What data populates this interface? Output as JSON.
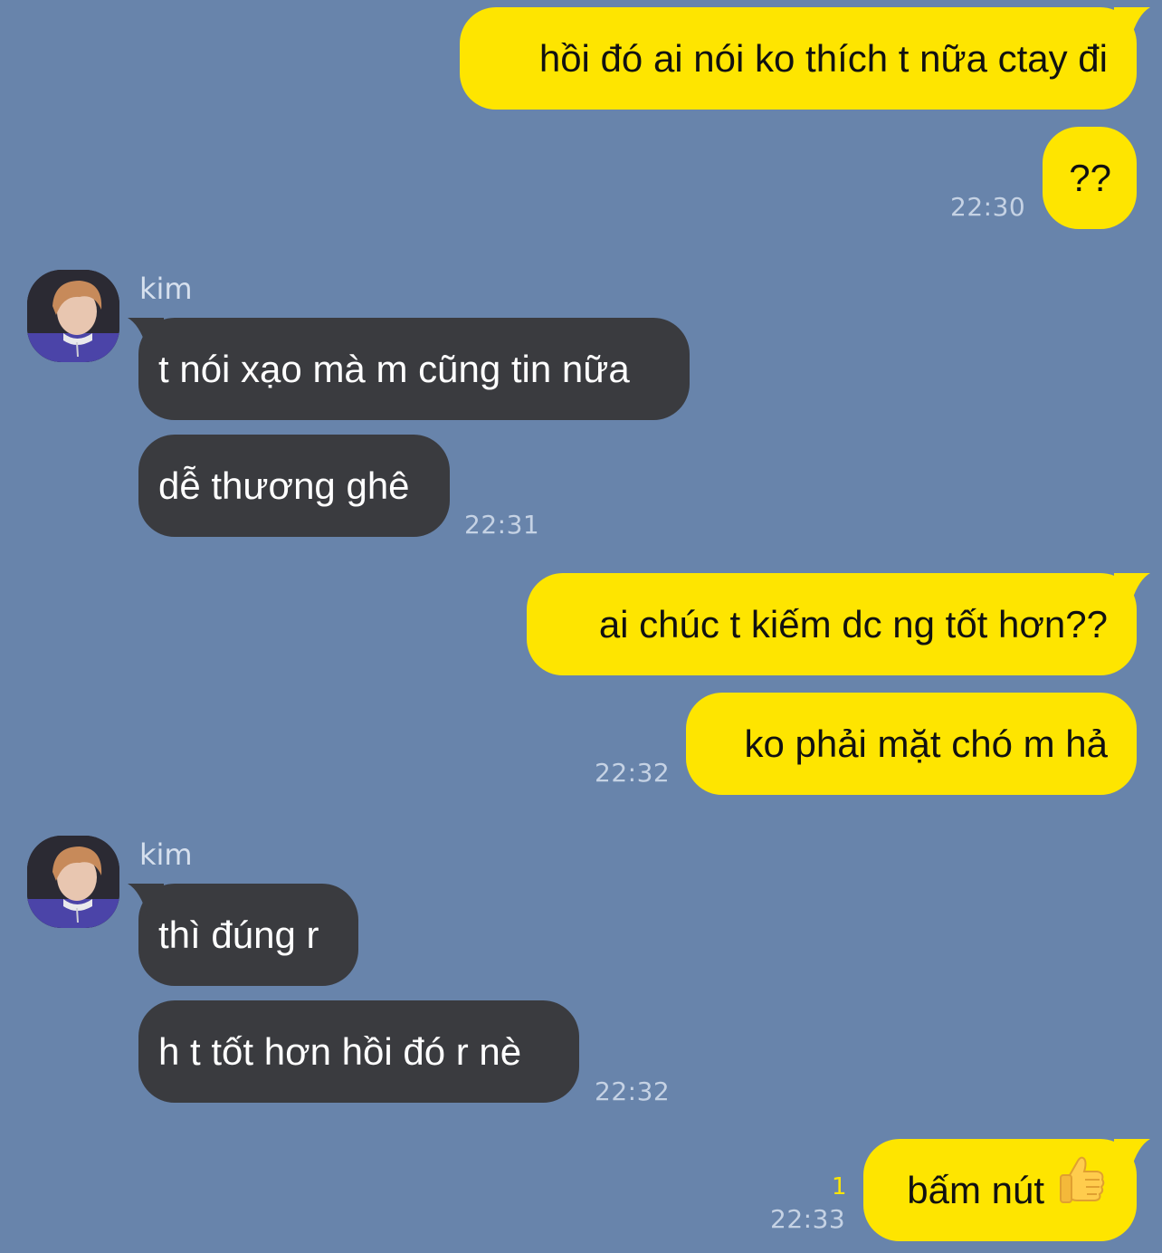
{
  "messages": {
    "m1": {
      "text": "hồi đó ai nói ko thích t nữa ctay đi"
    },
    "m2": {
      "text": "??",
      "time": "22:30"
    },
    "group1": {
      "sender": "kim"
    },
    "m3": {
      "text": "t nói xạo mà m cũng tin nữa"
    },
    "m4": {
      "text": "dễ thương ghê",
      "time": "22:31"
    },
    "m5": {
      "text": "ai chúc t kiếm dc ng tốt hơn??"
    },
    "m6": {
      "text": "ko phải mặt chó m hả",
      "time": "22:32"
    },
    "group2": {
      "sender": "kim"
    },
    "m7": {
      "text": "thì đúng r"
    },
    "m8": {
      "text": "h t tốt hơn hồi đó r nè",
      "time": "22:32"
    },
    "m9": {
      "text": "bấm nút",
      "emoji": "thumbs-up-icon",
      "time": "22:33",
      "unread": "1"
    }
  },
  "colors": {
    "background": "#6884ab",
    "sent_bubble": "#fee500",
    "received_bubble": "#3a3b3f"
  }
}
